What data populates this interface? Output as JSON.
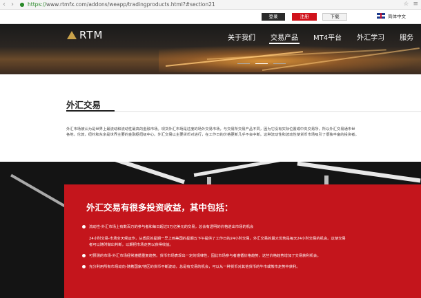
{
  "browser": {
    "url_protocol": "https://",
    "url_rest": "www.rtmfx.com/addons/weapp/tradingproducts.html?#section21"
  },
  "util": {
    "login": "登录",
    "register": "注册",
    "download": "下载",
    "language": "简体中文"
  },
  "brand": {
    "logo": "RTM",
    "accent_color": "#c9a24a",
    "brand_red": "#c4151c"
  },
  "nav": {
    "items": [
      {
        "label": "关于我们"
      },
      {
        "label": "交易产品"
      },
      {
        "label": "MT4平台"
      },
      {
        "label": "外汇学习"
      },
      {
        "label": "服务"
      }
    ],
    "active_index": 1
  },
  "page": {
    "title": "外汇交易",
    "intro_line1": "外汇市场被认为是世界上最流动和流动性最高的金融市场。现货外汇市场是过度的场外交易市场，与交易所交易产品不同，因为它没有实际位置或中央交易所，所以外汇交易通市世",
    "intro_line2": "各地，伦敦，纽约和东京是世界主要的金融枢纽级中心。外汇交易以主要货币对进行，在工作日的价格更新几乎不会中断。这种流动性和波动性使货币市场吸引了很独丰富的投资者。"
  },
  "panel": {
    "title": "外汇交易有很多投资收益，其中包括：",
    "line1": "流动性-外汇市场上有数百万的参与者和每日超过5万亿美元的交易，总会有透明的价格进出市场的机会",
    "line2": "24小时交易-市场全天候运作，从悉尼的星期一早上到美国的星期五下午提供了工作日的24小时交易。外汇交易的最大优势是每天24小时交易的机会。这使交易",
    "line3": "者可以随时做出判断，以期把市场走势以获得收益。",
    "line4": "可预测的市场-外汇市场经常遵循重复趋势。货币市场表现出一定的规律性，因此市场参与者遵循价格趋势，这些价格趋势增加了交易获利机会。",
    "line5": "充分利用所有市场动向-随着国家/地区的货币不断波动，总是有交易的机会，可以从一种货币对其他货币的牛市或熊市走势中获利。"
  }
}
